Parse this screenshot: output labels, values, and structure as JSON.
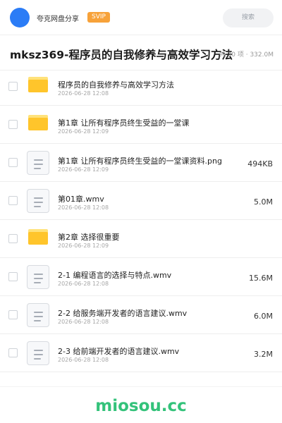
{
  "header": {
    "share_name": "夸克网盘分享",
    "badge": "SVIP",
    "search_placeholder": "搜索"
  },
  "folder": {
    "title": "mksz369-程序员的自我修养与高效学习方法",
    "summary": "共 30 项 · 332.0M"
  },
  "items": [
    {
      "type": "folder",
      "name": "程序员的自我修养与高效学习方法",
      "date": "2026-06-28 12:08",
      "size": ""
    },
    {
      "type": "folder",
      "name": "第1章 让所有程序员终生受益的一堂课",
      "date": "2026-06-28 12:09",
      "size": ""
    },
    {
      "type": "file",
      "name": "第1章 让所有程序员终生受益的一堂课资料.png",
      "date": "2026-06-28 12:09",
      "size": "494KB"
    },
    {
      "type": "file",
      "name": "第01章.wmv",
      "date": "2026-06-28 12:08",
      "size": "5.0M"
    },
    {
      "type": "folder",
      "name": "第2章 选择很重要",
      "date": "2026-06-28 12:09",
      "size": ""
    },
    {
      "type": "file",
      "name": "2-1 编程语言的选择与特点.wmv",
      "date": "2026-06-28 12:08",
      "size": "15.6M"
    },
    {
      "type": "file",
      "name": "2-2 给服务端开发者的语言建议.wmv",
      "date": "2026-06-28 12:08",
      "size": "6.0M"
    },
    {
      "type": "file",
      "name": "2-3 给前端开发者的语言建议.wmv",
      "date": "2026-06-28 12:08",
      "size": "3.2M"
    }
  ],
  "footer": {
    "watermark": "miosou.cc"
  },
  "colors": {
    "avatar": "#2b7cf6",
    "badge": "#f7a23a",
    "folder": "#ffc52b",
    "watermark": "#33c27a"
  },
  "icons": {
    "folder": "folder-icon",
    "file": "file-icon"
  }
}
